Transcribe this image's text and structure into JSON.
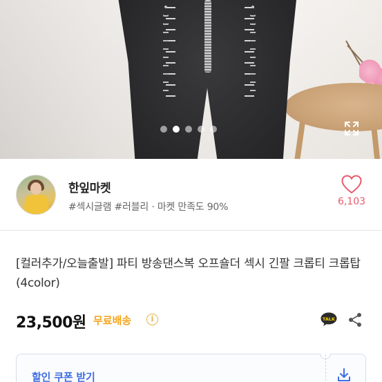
{
  "gallery": {
    "image_alt": "",
    "slide_count": 5,
    "active_slide": 2
  },
  "seller": {
    "name": "한잎마켓",
    "tags": "#섹시글램 #러블리 · 마켓 만족도 90%",
    "like_count": "6,103"
  },
  "product": {
    "title": "[컬러추가/오늘출발] 파티 방송댄스복 오프숄더 섹시 긴팔 크롭티 크롭탑 (4color)",
    "price": "23,500원",
    "shipping": "무료배송"
  },
  "coupon": {
    "label": "할인 쿠폰 받기"
  },
  "icons": {
    "like": "heart-icon",
    "info": "info-icon",
    "talk": "talk-icon",
    "share": "share-icon",
    "expand": "expand-icon",
    "download": "download-icon"
  },
  "colors": {
    "like": "#e65a6b",
    "shipping": "#f3a520",
    "coupon_label": "#3c6de0"
  }
}
